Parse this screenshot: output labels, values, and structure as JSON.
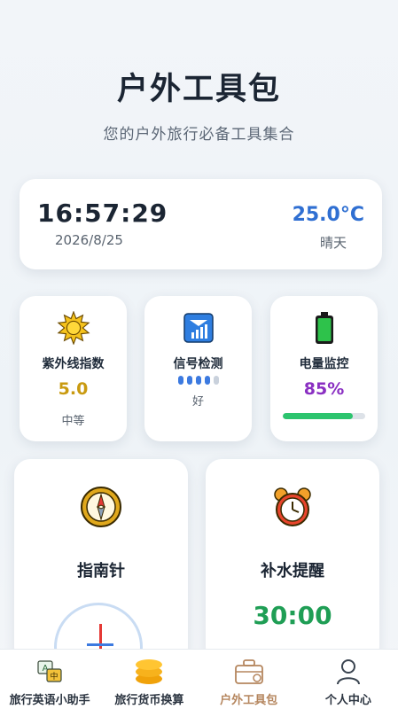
{
  "header": {
    "title": "户外工具包",
    "subtitle": "您的户外旅行必备工具集合"
  },
  "time_card": {
    "time": "16:57:29",
    "date": "2026/8/25",
    "temperature": "25.0°C",
    "weather": "晴天"
  },
  "cards": {
    "uv": {
      "label": "紫外线指数",
      "value": "5.0",
      "level": "中等",
      "icon": "sun-icon"
    },
    "signal": {
      "label": "信号检测",
      "quality": "好",
      "bars_on": 4,
      "bars_total": 5,
      "icon": "signal-icon"
    },
    "battery": {
      "label": "电量监控",
      "value": "85%",
      "level": 0.85,
      "icon": "battery-icon"
    },
    "compass": {
      "label": "指南针",
      "icon": "compass-icon"
    },
    "water": {
      "label": "补水提醒",
      "timer": "30:00",
      "icon": "alarm-clock-icon"
    }
  },
  "tabs": [
    {
      "label": "旅行英语小助手",
      "icon": "translate-icon",
      "active": false
    },
    {
      "label": "旅行货币换算",
      "icon": "coins-icon",
      "active": false
    },
    {
      "label": "户外工具包",
      "icon": "toolbox-icon",
      "active": true
    },
    {
      "label": "个人中心",
      "icon": "user-icon",
      "active": false
    }
  ],
  "colors": {
    "accent_blue": "#2f6fd2",
    "uv": "#c99a10",
    "battery": "#8a2fc2",
    "timer": "#1f9e55",
    "active_tab": "#b5865e"
  }
}
